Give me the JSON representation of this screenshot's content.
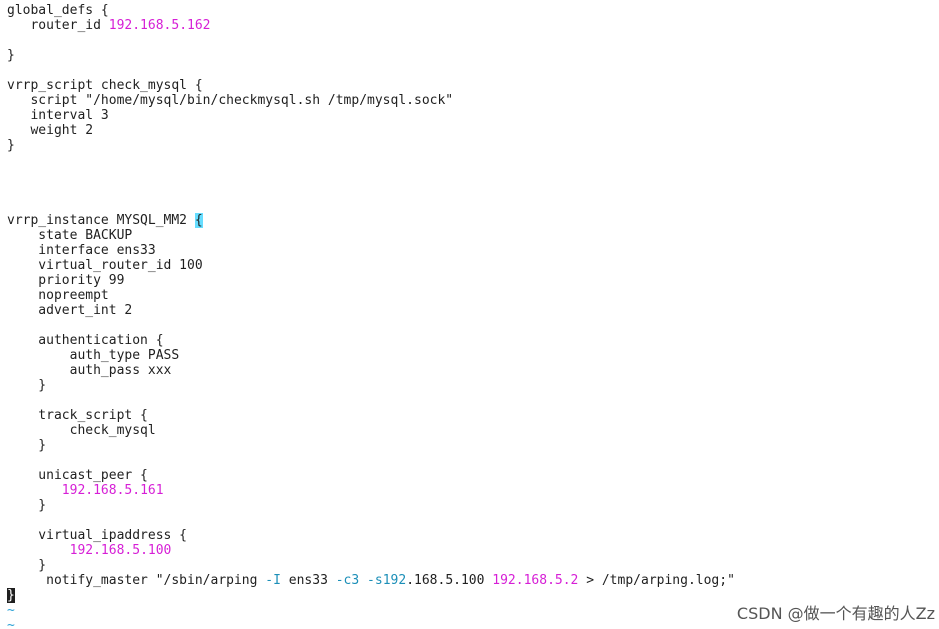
{
  "colors": {
    "background": "#ffffff",
    "text": "#1f1f1f",
    "number": "#d61fd6",
    "option": "#1c8fb8",
    "cursor_highlight": "#66ddff",
    "tilde": "#2aa1d6"
  },
  "editor": {
    "lines": [
      {
        "row": 0,
        "tokens": [
          {
            "t": "global_defs {"
          }
        ]
      },
      {
        "row": 1,
        "tokens": [
          {
            "t": "   router_id "
          },
          {
            "t": "192.168.5.162",
            "c": "num"
          }
        ]
      },
      {
        "row": 3,
        "tokens": [
          {
            "t": "}"
          }
        ]
      },
      {
        "row": 5,
        "tokens": [
          {
            "t": "vrrp_script check_mysql {"
          }
        ]
      },
      {
        "row": 6,
        "tokens": [
          {
            "t": "   script \"/home/mysql/bin/checkmysql.sh /tmp/mysql.sock\""
          }
        ]
      },
      {
        "row": 7,
        "tokens": [
          {
            "t": "   interval 3"
          }
        ]
      },
      {
        "row": 8,
        "tokens": [
          {
            "t": "   weight 2"
          }
        ]
      },
      {
        "row": 9,
        "tokens": [
          {
            "t": "}"
          }
        ]
      },
      {
        "row": 14,
        "tokens": [
          {
            "t": "vrrp_instance MYSQL_MM2 "
          },
          {
            "t": "{",
            "c": "cursor-brace"
          }
        ]
      },
      {
        "row": 15,
        "tokens": [
          {
            "t": "    state BACKUP"
          }
        ]
      },
      {
        "row": 16,
        "tokens": [
          {
            "t": "    interface ens33"
          }
        ]
      },
      {
        "row": 17,
        "tokens": [
          {
            "t": "    virtual_router_id 100"
          }
        ]
      },
      {
        "row": 18,
        "tokens": [
          {
            "t": "    priority 99"
          }
        ]
      },
      {
        "row": 19,
        "tokens": [
          {
            "t": "    nopreempt"
          }
        ]
      },
      {
        "row": 20,
        "tokens": [
          {
            "t": "    advert_int 2"
          }
        ]
      },
      {
        "row": 22,
        "tokens": [
          {
            "t": "    authentication {"
          }
        ]
      },
      {
        "row": 23,
        "tokens": [
          {
            "t": "        auth_type PASS"
          }
        ]
      },
      {
        "row": 24,
        "tokens": [
          {
            "t": "        auth_pass xxx"
          }
        ]
      },
      {
        "row": 25,
        "tokens": [
          {
            "t": "    }"
          }
        ]
      },
      {
        "row": 27,
        "tokens": [
          {
            "t": "    track_script {"
          }
        ]
      },
      {
        "row": 28,
        "tokens": [
          {
            "t": "        check_mysql"
          }
        ]
      },
      {
        "row": 29,
        "tokens": [
          {
            "t": "    }"
          }
        ]
      },
      {
        "row": 31,
        "tokens": [
          {
            "t": "    unicast_peer {"
          }
        ]
      },
      {
        "row": 32,
        "tokens": [
          {
            "t": "       "
          },
          {
            "t": "192.168.5.161",
            "c": "num"
          }
        ]
      },
      {
        "row": 33,
        "tokens": [
          {
            "t": "    }"
          }
        ]
      },
      {
        "row": 35,
        "tokens": [
          {
            "t": "    virtual_ipaddress {"
          }
        ]
      },
      {
        "row": 36,
        "tokens": [
          {
            "t": "        "
          },
          {
            "t": "192.168.5.100",
            "c": "num"
          }
        ]
      },
      {
        "row": 37,
        "tokens": [
          {
            "t": "    }"
          }
        ]
      },
      {
        "row": 38,
        "tokens": [
          {
            "t": "     notify_master \"/sbin/arping "
          },
          {
            "t": "-I",
            "c": "opt"
          },
          {
            "t": " ens33 "
          },
          {
            "t": "-c3",
            "c": "opt"
          },
          {
            "t": " "
          },
          {
            "t": "-s192",
            "c": "opt"
          },
          {
            "t": ".168.5.100 "
          },
          {
            "t": "192.168.5.2",
            "c": "num"
          },
          {
            "t": " > /tmp/arping.log;\""
          }
        ]
      },
      {
        "row": 39,
        "tokens": [
          {
            "t": "}",
            "c": "end-cursor"
          }
        ]
      },
      {
        "row": 40,
        "tokens": [
          {
            "t": "~",
            "c": "tilde"
          }
        ]
      },
      {
        "row": 41,
        "tokens": [
          {
            "t": "~",
            "c": "tilde"
          }
        ]
      }
    ]
  },
  "watermark": "CSDN @做一个有趣的人Zz"
}
